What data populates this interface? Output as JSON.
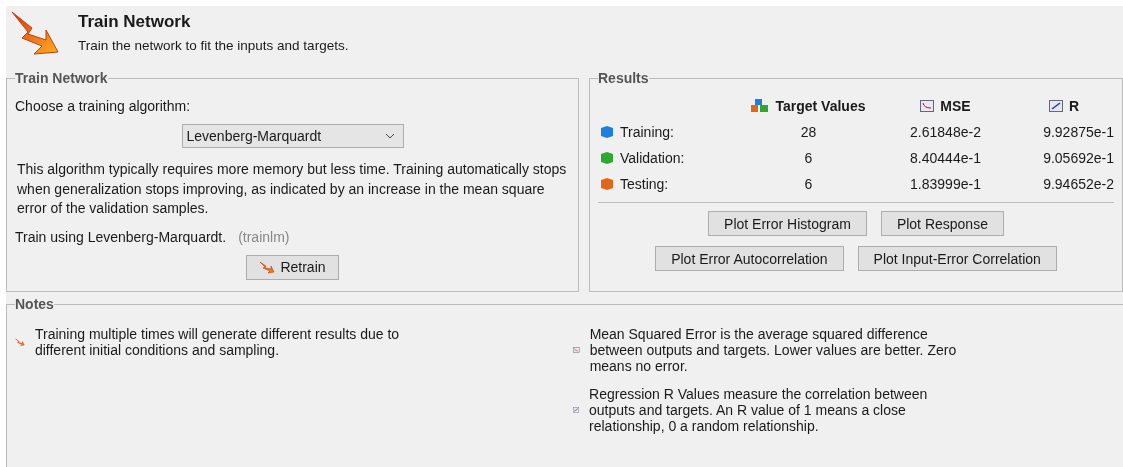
{
  "header": {
    "title": "Train Network",
    "subtitle": "Train the network to fit the inputs and targets."
  },
  "train_panel": {
    "title": "Train Network",
    "prompt": "Choose a training algorithm:",
    "algorithm": "Levenberg-Marquardt",
    "description": "This algorithm typically requires more memory but less time. Training automatically stops when generalization stops improving, as indicated by an increase in the mean square error of the validation samples.",
    "train_using": "Train using Levenberg-Marquardt.",
    "function_name": "(trainlm)",
    "retrain_button": "Retrain"
  },
  "results": {
    "title": "Results",
    "columns": [
      "Target Values",
      "MSE",
      "R"
    ],
    "rows": [
      {
        "label": "Training:",
        "color": "#1f7fe0",
        "values": [
          "28",
          "2.61848e-2",
          "9.92875e-1"
        ]
      },
      {
        "label": "Validation:",
        "color": "#2fa82f",
        "values": [
          "6",
          "8.40444e-1",
          "9.05692e-1"
        ]
      },
      {
        "label": "Testing:",
        "color": "#e0661a",
        "values": [
          "6",
          "1.83999e-1",
          "9.94652e-2"
        ]
      }
    ],
    "buttons": [
      [
        "Plot Error Histogram",
        "Plot Response"
      ],
      [
        "Plot Error Autocorrelation",
        "Plot Input-Error Correlation"
      ]
    ]
  },
  "notes": {
    "title": "Notes",
    "items": [
      {
        "kind": "train",
        "text": "Training multiple times will generate different results due to different initial conditions and sampling."
      },
      {
        "kind": "mse",
        "text": "Mean Squared Error is the average squared difference between outputs and targets. Lower values are better. Zero means no error."
      },
      {
        "kind": "r",
        "text": "Regression R Values measure the correlation between outputs and targets. An R value of 1 means a close relationship, 0 a random relationship."
      }
    ]
  }
}
